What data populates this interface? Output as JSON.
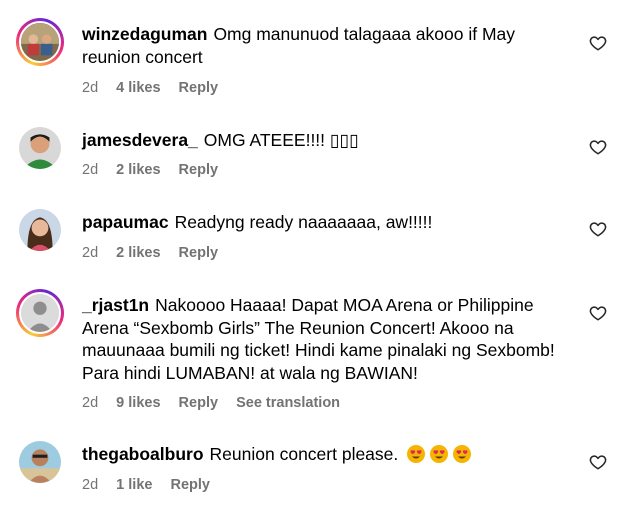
{
  "colors": {
    "text": "#000000",
    "meta": "#737373",
    "story_ring": [
      "#f9ce34",
      "#ee2a7b",
      "#6228d7"
    ],
    "emoji_face": "#f5b400",
    "emoji_heart": "#e0245e"
  },
  "comments": [
    {
      "username": "winzedaguman",
      "text": "Omg manunuod talagaaa akooo if May reunion concert",
      "age": "2d",
      "likes": "4 likes",
      "reply": "Reply",
      "avatar": "avatar-photo-group",
      "story_ring": true
    },
    {
      "username": "jamesdevera_",
      "text": "OMG ATEEE!!!! ▯▯▯",
      "age": "2d",
      "likes": "2 likes",
      "reply": "Reply",
      "avatar": "avatar-photo-green-shirt",
      "story_ring": false
    },
    {
      "username": "papaumac",
      "text": "Readyng ready naaaaaaa, aw!!!!!",
      "age": "2d",
      "likes": "2 likes",
      "reply": "Reply",
      "avatar": "avatar-photo-woman",
      "story_ring": false
    },
    {
      "username": "_rjast1n",
      "text": "Nakoooo Haaaa! Dapat MOA Arena or Philippine Arena “Sexbomb Girls” The Reunion Concert! Akooo na mauunaaa bumili ng ticket! Hindi kame pinalaki ng Sexbomb! Para hindi LUMABAN! at wala ng BAWIAN!",
      "age": "2d",
      "likes": "9 likes",
      "reply": "Reply",
      "translate": "See translation",
      "avatar": "avatar-default-silhouette",
      "story_ring": true
    },
    {
      "username": "thegaboalburo",
      "text": "Reunion concert please.",
      "emojis": [
        "heart-eyes-emoji",
        "heart-eyes-emoji",
        "heart-eyes-emoji"
      ],
      "age": "2d",
      "likes": "1 like",
      "reply": "Reply",
      "avatar": "avatar-photo-beach",
      "story_ring": false
    }
  ]
}
